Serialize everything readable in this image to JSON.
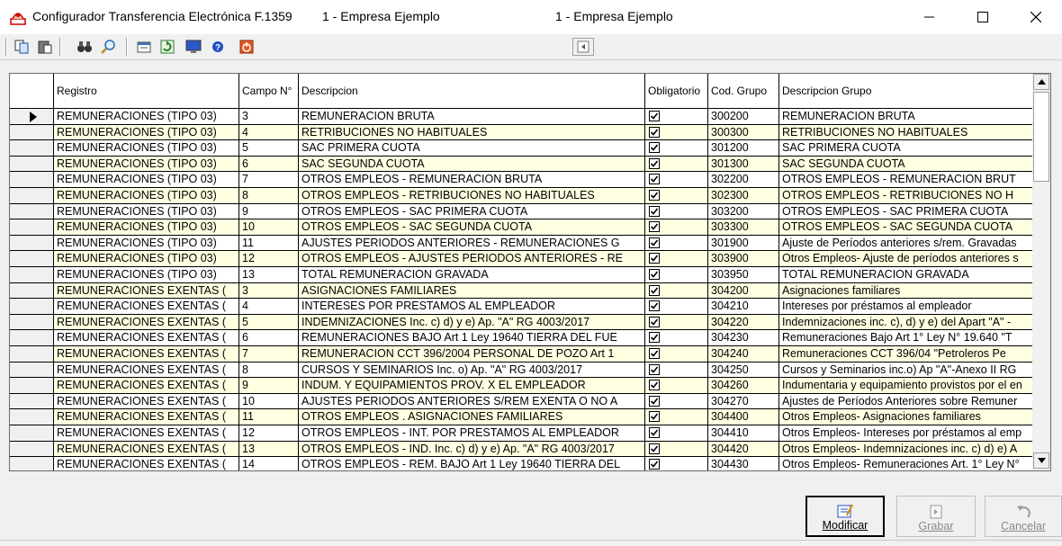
{
  "window": {
    "title": "Configurador Transferencia Electrónica F.1359",
    "company_1": "1 - Empresa Ejemplo",
    "company_2": "1 - Empresa Ejemplo"
  },
  "grid": {
    "headers": [
      "Registro",
      "Campo N°",
      "Descripcion",
      "Obligatorio",
      "Cod. Grupo",
      "Descripcion Grupo"
    ],
    "rows": [
      {
        "registro": "REMUNERACIONES (TIPO 03)",
        "campo": "3",
        "descripcion": "REMUNERACION BRUTA",
        "obligatorio": true,
        "cod": "300200",
        "grupo": "REMUNERACION BRUTA"
      },
      {
        "registro": "REMUNERACIONES (TIPO 03)",
        "campo": "4",
        "descripcion": "RETRIBUCIONES NO HABITUALES",
        "obligatorio": true,
        "cod": "300300",
        "grupo": "RETRIBUCIONES NO HABITUALES"
      },
      {
        "registro": "REMUNERACIONES (TIPO 03)",
        "campo": "5",
        "descripcion": "SAC PRIMERA CUOTA",
        "obligatorio": true,
        "cod": "301200",
        "grupo": "SAC PRIMERA CUOTA"
      },
      {
        "registro": "REMUNERACIONES (TIPO 03)",
        "campo": "6",
        "descripcion": "SAC SEGUNDA CUOTA",
        "obligatorio": true,
        "cod": "301300",
        "grupo": "SAC SEGUNDA CUOTA"
      },
      {
        "registro": "REMUNERACIONES (TIPO 03)",
        "campo": "7",
        "descripcion": "OTROS EMPLEOS - REMUNERACION BRUTA",
        "obligatorio": true,
        "cod": "302200",
        "grupo": "OTROS EMPLEOS - REMUNERACION BRUT"
      },
      {
        "registro": "REMUNERACIONES (TIPO 03)",
        "campo": "8",
        "descripcion": "OTROS EMPLEOS - RETRIBUCIONES NO HABITUALES",
        "obligatorio": true,
        "cod": "302300",
        "grupo": "OTROS EMPLEOS - RETRIBUCIONES NO H"
      },
      {
        "registro": "REMUNERACIONES (TIPO 03)",
        "campo": "9",
        "descripcion": "OTROS EMPLEOS - SAC PRIMERA CUOTA",
        "obligatorio": true,
        "cod": "303200",
        "grupo": "OTROS EMPLEOS - SAC PRIMERA CUOTA"
      },
      {
        "registro": "REMUNERACIONES (TIPO 03)",
        "campo": "10",
        "descripcion": "OTROS EMPLEOS - SAC SEGUNDA CUOTA",
        "obligatorio": true,
        "cod": "303300",
        "grupo": "OTROS EMPLEOS - SAC SEGUNDA CUOTA"
      },
      {
        "registro": "REMUNERACIONES (TIPO 03)",
        "campo": "11",
        "descripcion": "AJUSTES PERIODOS ANTERIORES - REMUNERACIONES G",
        "obligatorio": true,
        "cod": "301900",
        "grupo": "Ajuste de Períodos anteriores s/rem. Gravadas"
      },
      {
        "registro": "REMUNERACIONES (TIPO 03)",
        "campo": "12",
        "descripcion": "OTROS EMPLEOS - AJUSTES PERIODOS ANTERIORES - RE",
        "obligatorio": true,
        "cod": "303900",
        "grupo": "Otros Empleos- Ajuste de períodos anteriores s"
      },
      {
        "registro": "REMUNERACIONES (TIPO 03)",
        "campo": "13",
        "descripcion": "TOTAL REMUNERACION GRAVADA",
        "obligatorio": true,
        "cod": "303950",
        "grupo": "TOTAL REMUNERACION GRAVADA"
      },
      {
        "registro": "REMUNERACIONES EXENTAS (",
        "campo": "3",
        "descripcion": "ASIGNACIONES FAMILIARES",
        "obligatorio": true,
        "cod": "304200",
        "grupo": "Asignaciones familiares"
      },
      {
        "registro": "REMUNERACIONES EXENTAS (",
        "campo": "4",
        "descripcion": "INTERESES POR PRESTAMOS AL EMPLEADOR",
        "obligatorio": true,
        "cod": "304210",
        "grupo": "Intereses por préstamos al empleador"
      },
      {
        "registro": "REMUNERACIONES EXENTAS (",
        "campo": "5",
        "descripcion": "INDEMNIZACIONES Inc. c) d) y e) Ap.  \"A\" RG 4003/2017",
        "obligatorio": true,
        "cod": "304220",
        "grupo": "Indemnizaciones inc. c), d) y e) del Apart \"A\" -"
      },
      {
        "registro": "REMUNERACIONES EXENTAS (",
        "campo": "6",
        "descripcion": "REMUNERACIONES BAJO Art 1 Ley 19640 TIERRA DEL FUE",
        "obligatorio": true,
        "cod": "304230",
        "grupo": "Remuneraciones Bajo Art 1° Ley N° 19.640 \"T"
      },
      {
        "registro": "REMUNERACIONES EXENTAS (",
        "campo": "7",
        "descripcion": "REMUNERACION CCT 396/2004 PERSONAL DE POZO Art 1",
        "obligatorio": true,
        "cod": "304240",
        "grupo": "Remuneraciones  CCT 396/04 \"Petroleros  Pe"
      },
      {
        "registro": "REMUNERACIONES EXENTAS (",
        "campo": "8",
        "descripcion": "CURSOS Y SEMINARIOS Inc. o) Ap. \"A\" RG 4003/2017",
        "obligatorio": true,
        "cod": "304250",
        "grupo": "Cursos y Seminarios inc.o)  Ap \"A\"-Anexo II RG"
      },
      {
        "registro": "REMUNERACIONES EXENTAS (",
        "campo": "9",
        "descripcion": "INDUM. Y EQUIPAMIENTOS PROV. X EL EMPLEADOR",
        "obligatorio": true,
        "cod": "304260",
        "grupo": "Indumentaria y equipamiento provistos por el en"
      },
      {
        "registro": "REMUNERACIONES EXENTAS (",
        "campo": "10",
        "descripcion": "AJUSTES PERIODOS ANTERIORES S/REM EXENTA O NO A",
        "obligatorio": true,
        "cod": "304270",
        "grupo": "Ajustes de Períodos Anteriores sobre Remuner"
      },
      {
        "registro": "REMUNERACIONES EXENTAS (",
        "campo": "11",
        "descripcion": "OTROS EMPLEOS . ASIGNACIONES FAMILIARES",
        "obligatorio": true,
        "cod": "304400",
        "grupo": "Otros Empleos- Asignaciones familiares"
      },
      {
        "registro": "REMUNERACIONES EXENTAS (",
        "campo": "12",
        "descripcion": "OTROS EMPLEOS - INT. POR PRESTAMOS AL EMPLEADOR",
        "obligatorio": true,
        "cod": "304410",
        "grupo": "Otros Empleos- Intereses por préstamos al emp"
      },
      {
        "registro": "REMUNERACIONES EXENTAS (",
        "campo": "13",
        "descripcion": "OTROS EMPLEOS - IND. Inc. c) d) y e) Ap. \"A\" RG 4003/2017",
        "obligatorio": true,
        "cod": "304420",
        "grupo": "Otros Empleos- Indemnizaciones  inc. c) d) e) A"
      },
      {
        "registro": "REMUNERACIONES EXENTAS (",
        "campo": "14",
        "descripcion": "OTROS EMPLEOS - REM. BAJO Art 1 Ley 19640 TIERRA DEL",
        "obligatorio": true,
        "cod": "304430",
        "grupo": "Otros Empleos- Remuneraciones Art. 1° Ley N°"
      }
    ]
  },
  "buttons": {
    "modificar": "Modificar",
    "grabar": "Grabar",
    "cancelar": "Cancelar"
  },
  "colors": {
    "row_even": "#ffffff",
    "row_odd": "#ffffe1"
  },
  "toolbar_icons": [
    "copy-icon",
    "paste-icon",
    "binoculars-icon",
    "magnifier-icon",
    "filter-icon",
    "refresh-icon",
    "monitor-icon",
    "help-icon",
    "power-icon",
    "back-icon"
  ]
}
